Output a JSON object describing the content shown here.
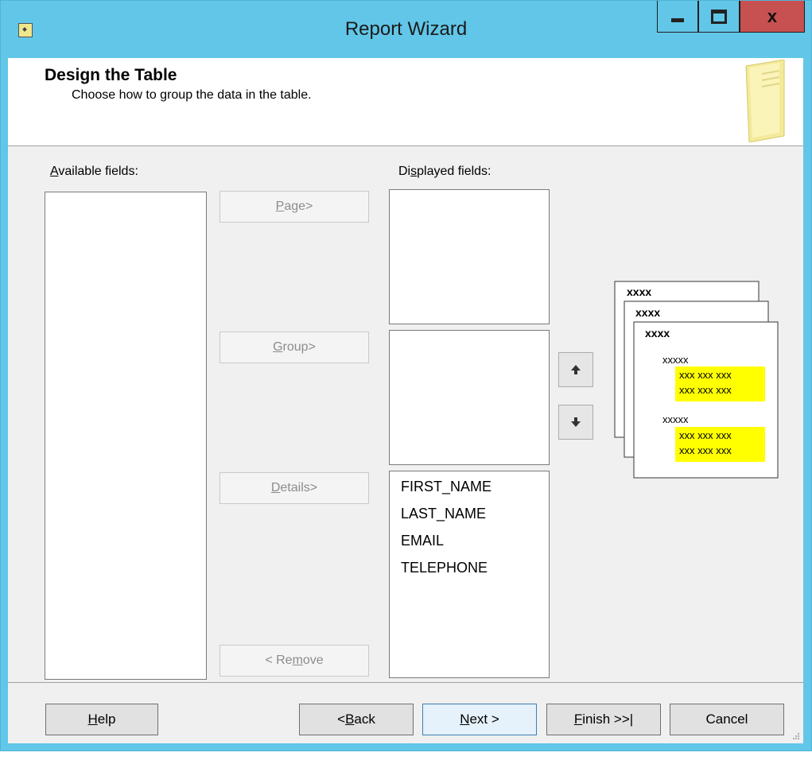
{
  "window": {
    "title": "Report Wizard",
    "close_glyph": "x"
  },
  "header": {
    "title": "Design the Table",
    "subtitle": "Choose how to group the data in the table."
  },
  "available": {
    "label_first": "A",
    "label_rest": "vailable fields:",
    "items": []
  },
  "displayed": {
    "label_first": "Di",
    "label_u": "s",
    "label_rest": "played fields:",
    "page_items": [],
    "group_items": [],
    "detail_items": [
      "FIRST_NAME",
      "LAST_NAME",
      "EMAIL",
      "TELEPHONE"
    ]
  },
  "buttons": {
    "page": {
      "u": "P",
      "rest": "age>"
    },
    "group": {
      "u": "G",
      "rest": "roup>"
    },
    "details": {
      "u": "D",
      "rest": "etails>"
    },
    "remove": {
      "pre": "< Re",
      "u": "m",
      "rest": "ove"
    }
  },
  "preview": {
    "heading": "xxxx",
    "subheading": "xxxxx",
    "row": "xxx xxx xxx",
    "highlight_color": "#ffff00"
  },
  "footer": {
    "help": {
      "u": "H",
      "rest": "elp"
    },
    "back": {
      "pre": "< ",
      "u": "B",
      "rest": "ack"
    },
    "next": {
      "u": "N",
      "rest": "ext >"
    },
    "finish": {
      "u": "F",
      "rest": "inish >>|"
    },
    "cancel": "Cancel"
  },
  "colors": {
    "titlebar": "#61c6e8",
    "close_button": "#c75050",
    "dialog_bg": "#f0f0f0"
  },
  "icons": [
    "wizard-app-icon",
    "minimize-icon",
    "maximize-icon",
    "close-icon",
    "notepad-icon",
    "arrow-up-icon",
    "arrow-down-icon",
    "size-grip-icon"
  ]
}
